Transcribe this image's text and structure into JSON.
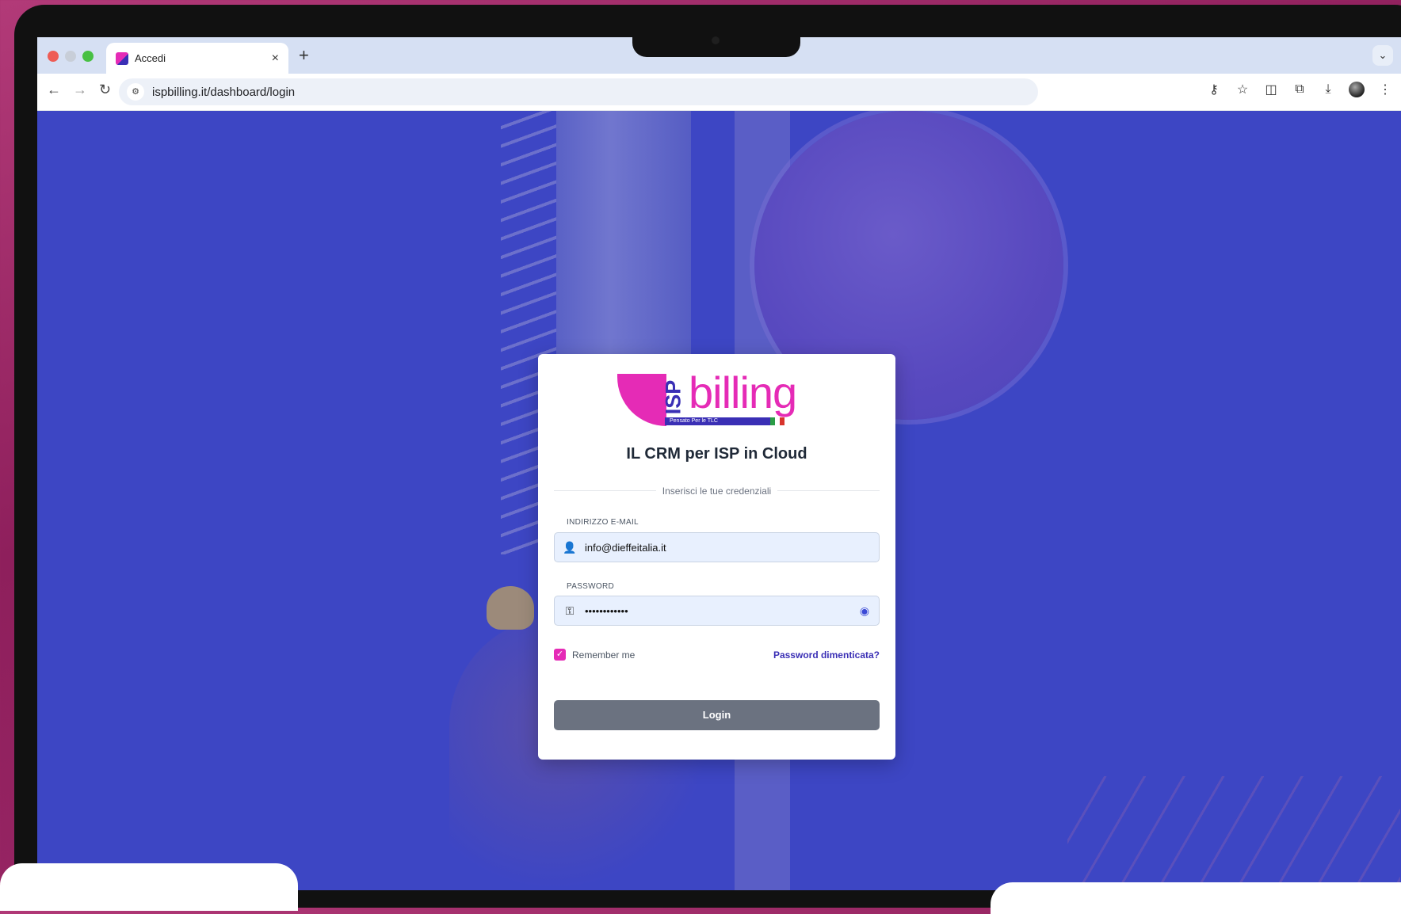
{
  "browser": {
    "tab_title": "Accedi",
    "tab_close": "×",
    "new_tab": "+",
    "url": "ispbilling.it/dashboard/login"
  },
  "logo": {
    "isp": "ISP",
    "billing": "billing",
    "tagline": "Pensato Per le TLC"
  },
  "login": {
    "title": "IL CRM per ISP in Cloud",
    "divider_text": "Inserisci le tue credenziali",
    "email_label": "INDIRIZZO E-MAIL",
    "email_value": "info@dieffeitalia.it",
    "password_label": "PASSWORD",
    "password_value": "••••••••••••",
    "remember_label": "Remember me",
    "remember_checked": true,
    "forgot_link": "Password dimenticata?",
    "login_button": "Login"
  },
  "colors": {
    "brand_pink": "#e52bb6",
    "brand_blue": "#3a2fb5",
    "background_overlay": "#3d46c4",
    "button": "#6b7280"
  }
}
